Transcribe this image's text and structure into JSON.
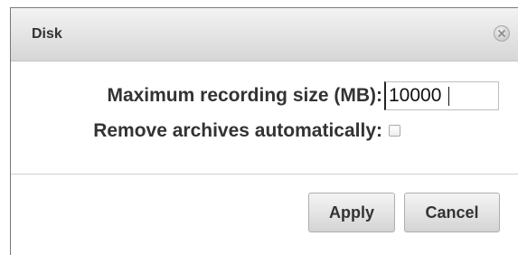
{
  "dialog": {
    "title": "Disk",
    "close_icon": "close-icon"
  },
  "form": {
    "max_size_label": "Maximum recording size (MB):",
    "max_size_value": "10000",
    "remove_label": "Remove archives automatically:",
    "remove_checked": false
  },
  "buttons": {
    "apply_label": "Apply",
    "cancel_label": "Cancel"
  },
  "colors": {
    "text": "#333333",
    "titlebar_top": "#f3f3f3",
    "titlebar_bottom": "#d6d6d6",
    "button_border": "#aeaeae"
  }
}
